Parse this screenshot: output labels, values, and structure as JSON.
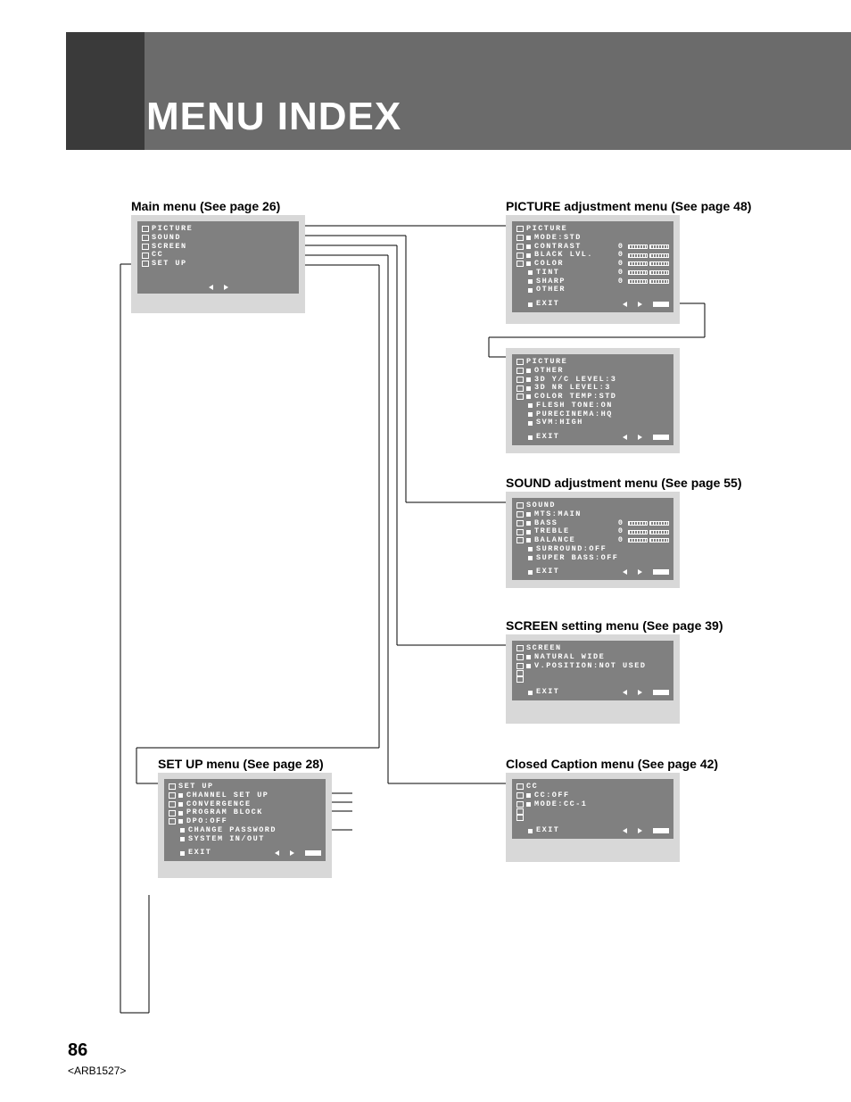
{
  "header": {
    "title": "MENU INDEX"
  },
  "labels": {
    "main": "Main menu (See page 26)",
    "picture": "PICTURE adjustment menu (See page 48)",
    "sound": "SOUND adjustment menu (See page 55)",
    "screen": "SCREEN setting menu (See page 39)",
    "cc": "Closed Caption menu (See page 42)",
    "setup": "SET UP menu (See page 28)"
  },
  "menus": {
    "main": {
      "title": "PICTURE",
      "items": [
        "SOUND",
        "SCREEN",
        "CC",
        "SET UP"
      ]
    },
    "picture": {
      "title": "PICTURE",
      "rows": [
        {
          "label": "MODE:STD"
        },
        {
          "label": "CONTRAST",
          "val": "0"
        },
        {
          "label": "BLACK LVL.",
          "val": "0"
        },
        {
          "label": "COLOR",
          "val": "0"
        },
        {
          "label": "TINT",
          "val": "0"
        },
        {
          "label": "SHARP",
          "val": "0"
        },
        {
          "label": "OTHER"
        }
      ],
      "exit": "EXIT"
    },
    "picture_other": {
      "title": "PICTURE",
      "sub": "OTHER",
      "rows": [
        {
          "label": "3D Y/C LEVEL:3"
        },
        {
          "label": "3D NR LEVEL:3"
        },
        {
          "label": "COLOR TEMP:STD"
        },
        {
          "label": "FLESH TONE:ON"
        },
        {
          "label": "PURECINEMA:HQ"
        },
        {
          "label": "SVM:HIGH"
        }
      ],
      "exit": "EXIT"
    },
    "sound": {
      "title": "SOUND",
      "rows": [
        {
          "label": "MTS:MAIN"
        },
        {
          "label": "BASS",
          "val": "0"
        },
        {
          "label": "TREBLE",
          "val": "0"
        },
        {
          "label": "BALANCE",
          "val": "0"
        },
        {
          "label": "SURROUND:OFF"
        },
        {
          "label": "SUPER BASS:OFF"
        }
      ],
      "exit": "EXIT"
    },
    "screen": {
      "title": "SCREEN",
      "rows": [
        {
          "label": "NATURAL WIDE"
        },
        {
          "label": "V.POSITION:NOT USED"
        }
      ],
      "exit": "EXIT"
    },
    "cc": {
      "title": "CC",
      "rows": [
        {
          "label": "CC:OFF"
        },
        {
          "label": "MODE:CC-1"
        }
      ],
      "exit": "EXIT"
    },
    "setup": {
      "title": "SET UP",
      "rows": [
        {
          "label": "CHANNEL SET UP"
        },
        {
          "label": "CONVERGENCE"
        },
        {
          "label": "PROGRAM BLOCK"
        },
        {
          "label": "DPO:OFF"
        },
        {
          "label": "CHANGE PASSWORD"
        },
        {
          "label": "SYSTEM IN/OUT"
        }
      ],
      "exit": "EXIT"
    }
  },
  "footer": {
    "page": "86",
    "code": "<ARB1527>"
  }
}
